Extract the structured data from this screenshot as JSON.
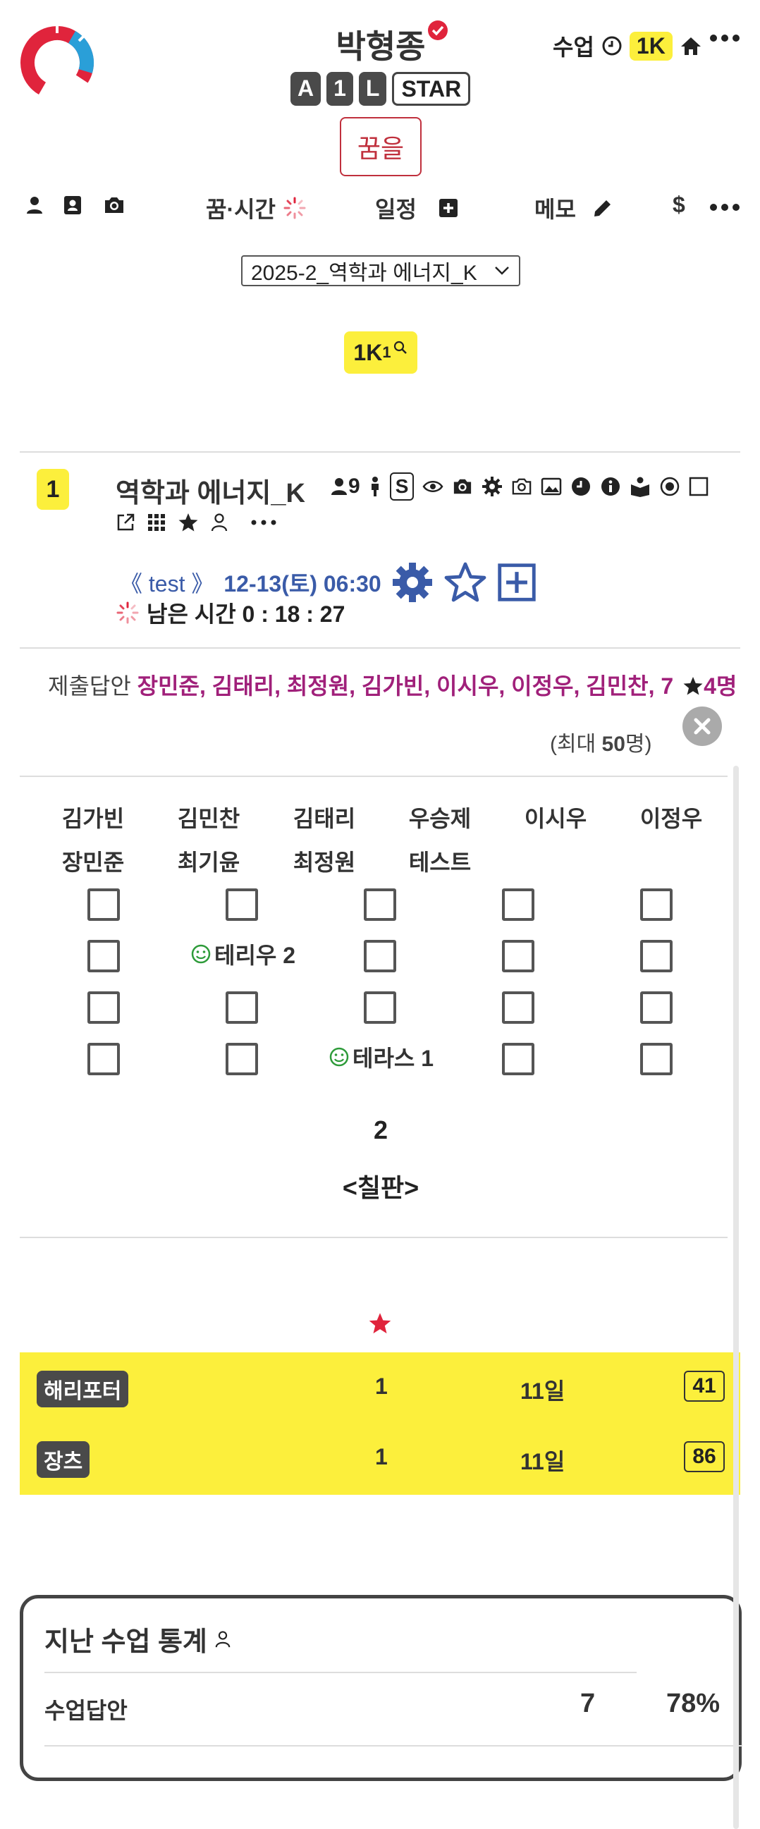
{
  "header": {
    "user_name": "박형종",
    "badges": [
      "A",
      "1",
      "L"
    ],
    "badge_outline": "STAR",
    "dream_button": "꿈을",
    "top_right_label": "수업",
    "top_right_k": "1K"
  },
  "nav": {
    "dream_time": "꿈·시간",
    "schedule": "일정",
    "memo": "메모",
    "dollar": "$"
  },
  "semester_select": {
    "selected": "2025-2_역학과 에너지_K"
  },
  "k_badge": {
    "label": "1K",
    "sup": "1"
  },
  "class": {
    "number": "1",
    "title": "역학과 에너지_K",
    "member_count": "9",
    "s_label": "S",
    "test_label": "《 test 》",
    "datetime": "12-13(토) 06:30",
    "remaining": "남은 시간 0 : 18 : 27"
  },
  "submitted": {
    "prefix": "제출답안",
    "names": "장민준, 김태리, 최정원, 김가빈, 이시우, 이정우, 김민찬, 7",
    "stars": "4명",
    "max": "(최대 ",
    "max_num": "50",
    "max_suffix": "명)"
  },
  "students": {
    "row1": [
      "김가빈",
      "김민찬",
      "김태리",
      "우승제",
      "이시우",
      "이정우"
    ],
    "row2": [
      "장민준",
      "최기윤",
      "최정원",
      "테스트"
    ]
  },
  "seats": {
    "terio": "테리우 2",
    "teras": "테라스 1",
    "row_number": "2",
    "board": "<칠판>"
  },
  "ranking": [
    {
      "name": "해리포터",
      "count": "1",
      "days": "11일",
      "score": "41"
    },
    {
      "name": "장츠",
      "count": "1",
      "days": "11일",
      "score": "86"
    }
  ],
  "stats": {
    "title": "지난 수업 통계",
    "label": "수업답안",
    "count": "7",
    "percent": "78%"
  },
  "colors": {
    "accent_yellow": "#fcef3c",
    "brand_red": "#e0243c",
    "link_blue": "#3a5ba8",
    "name_purple": "#a0207a"
  }
}
